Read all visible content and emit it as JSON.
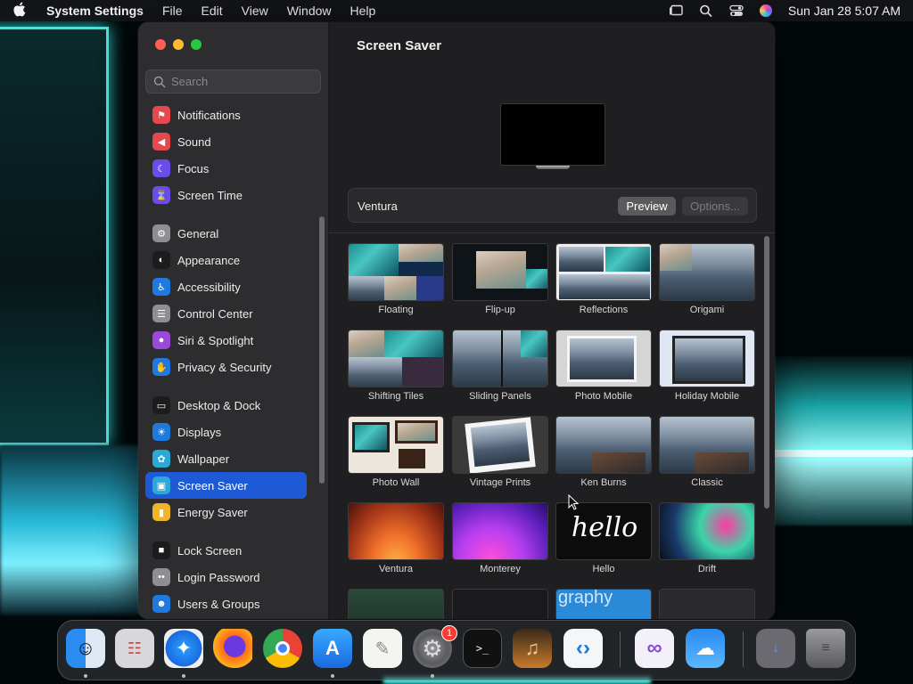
{
  "menubar": {
    "app_name": "System Settings",
    "menus": [
      "File",
      "Edit",
      "View",
      "Window",
      "Help"
    ],
    "clock": "Sun Jan 28  5:07 AM"
  },
  "sidebar": {
    "search_placeholder": "Search",
    "items": [
      {
        "label": "Notifications",
        "icon": "bell-icon",
        "color": "#e5484d"
      },
      {
        "label": "Sound",
        "icon": "speaker-icon",
        "color": "#e5484d"
      },
      {
        "label": "Focus",
        "icon": "moon-icon",
        "color": "#6a4de8"
      },
      {
        "label": "Screen Time",
        "icon": "hourglass-icon",
        "color": "#6a4de8"
      },
      {
        "label": "General",
        "icon": "gear-icon",
        "color": "#8e8e93"
      },
      {
        "label": "Appearance",
        "icon": "appearance-icon",
        "color": "#1c1c1e"
      },
      {
        "label": "Accessibility",
        "icon": "accessibility-icon",
        "color": "#1f7ae0"
      },
      {
        "label": "Control Center",
        "icon": "toggles-icon",
        "color": "#8e8e93"
      },
      {
        "label": "Siri & Spotlight",
        "icon": "siri-icon",
        "color": "#9a49d8"
      },
      {
        "label": "Privacy & Security",
        "icon": "hand-icon",
        "color": "#1f7ae0"
      },
      {
        "label": "Desktop & Dock",
        "icon": "dock-icon",
        "color": "#1c1c1e"
      },
      {
        "label": "Displays",
        "icon": "sun-icon",
        "color": "#1f7ae0"
      },
      {
        "label": "Wallpaper",
        "icon": "flower-icon",
        "color": "#2aa8d8"
      },
      {
        "label": "Screen Saver",
        "icon": "screensaver-icon",
        "color": "#2aa8d8"
      },
      {
        "label": "Energy Saver",
        "icon": "battery-icon",
        "color": "#f0b429"
      },
      {
        "label": "Lock Screen",
        "icon": "lock-icon",
        "color": "#1c1c1e"
      },
      {
        "label": "Login Password",
        "icon": "key-icon",
        "color": "#8e8e93"
      },
      {
        "label": "Users & Groups",
        "icon": "users-icon",
        "color": "#1f7ae0"
      }
    ],
    "active": "Screen Saver"
  },
  "main": {
    "title": "Screen Saver",
    "selected_saver": "Ventura",
    "preview_label": "Preview",
    "options_label": "Options...",
    "tiles": [
      {
        "label": "Floating",
        "motif": "mosaic"
      },
      {
        "label": "Flip-up",
        "motif": "flip"
      },
      {
        "label": "Reflections",
        "motif": "reflect"
      },
      {
        "label": "Origami",
        "motif": "origami"
      },
      {
        "label": "Shifting Tiles",
        "motif": "mosaic2"
      },
      {
        "label": "Sliding Panels",
        "motif": "sliding"
      },
      {
        "label": "Photo Mobile",
        "motif": "mobile"
      },
      {
        "label": "Holiday Mobile",
        "motif": "holiday"
      },
      {
        "label": "Photo Wall",
        "motif": "wall"
      },
      {
        "label": "Vintage Prints",
        "motif": "vintage"
      },
      {
        "label": "Ken Burns",
        "motif": "mtn"
      },
      {
        "label": "Classic",
        "motif": "mtn"
      },
      {
        "label": "Ventura",
        "motif": "ventura"
      },
      {
        "label": "Monterey",
        "motif": "monterey"
      },
      {
        "label": "Hello",
        "motif": "hello",
        "text": "hello"
      },
      {
        "label": "Drift",
        "motif": "drift"
      },
      {
        "label": "",
        "motif": "partial1"
      },
      {
        "label": "",
        "motif": "partial2"
      },
      {
        "label": "",
        "motif": "partial3",
        "text": "graphy"
      },
      {
        "label": "",
        "motif": "partial4"
      }
    ]
  },
  "dock": {
    "apps": [
      {
        "name": "Finder",
        "icon": "finder-icon",
        "running": true
      },
      {
        "name": "Launchpad",
        "icon": "launchpad-icon",
        "running": false
      },
      {
        "name": "Safari",
        "icon": "safari-icon",
        "running": true
      },
      {
        "name": "Firefox",
        "icon": "firefox-icon",
        "running": false
      },
      {
        "name": "Chrome",
        "icon": "chrome-icon",
        "running": false
      },
      {
        "name": "App Store",
        "icon": "appstore-icon",
        "running": true
      },
      {
        "name": "TextEdit",
        "icon": "textedit-icon",
        "running": false
      },
      {
        "name": "System Settings",
        "icon": "settings-icon",
        "running": true,
        "badge": "1"
      },
      {
        "name": "Terminal",
        "icon": "terminal-icon",
        "running": false
      },
      {
        "name": "GarageBand",
        "icon": "guitar-icon",
        "running": false
      },
      {
        "name": "VS Code",
        "icon": "vscode-icon",
        "running": false
      },
      {
        "name": "Visual Studio",
        "icon": "visualstudio-icon",
        "running": false
      },
      {
        "name": "Weather",
        "icon": "weather-icon",
        "running": false
      },
      {
        "name": "Downloads",
        "icon": "stack-icon",
        "running": false
      },
      {
        "name": "Trash",
        "icon": "trash-icon",
        "running": false
      }
    ]
  }
}
